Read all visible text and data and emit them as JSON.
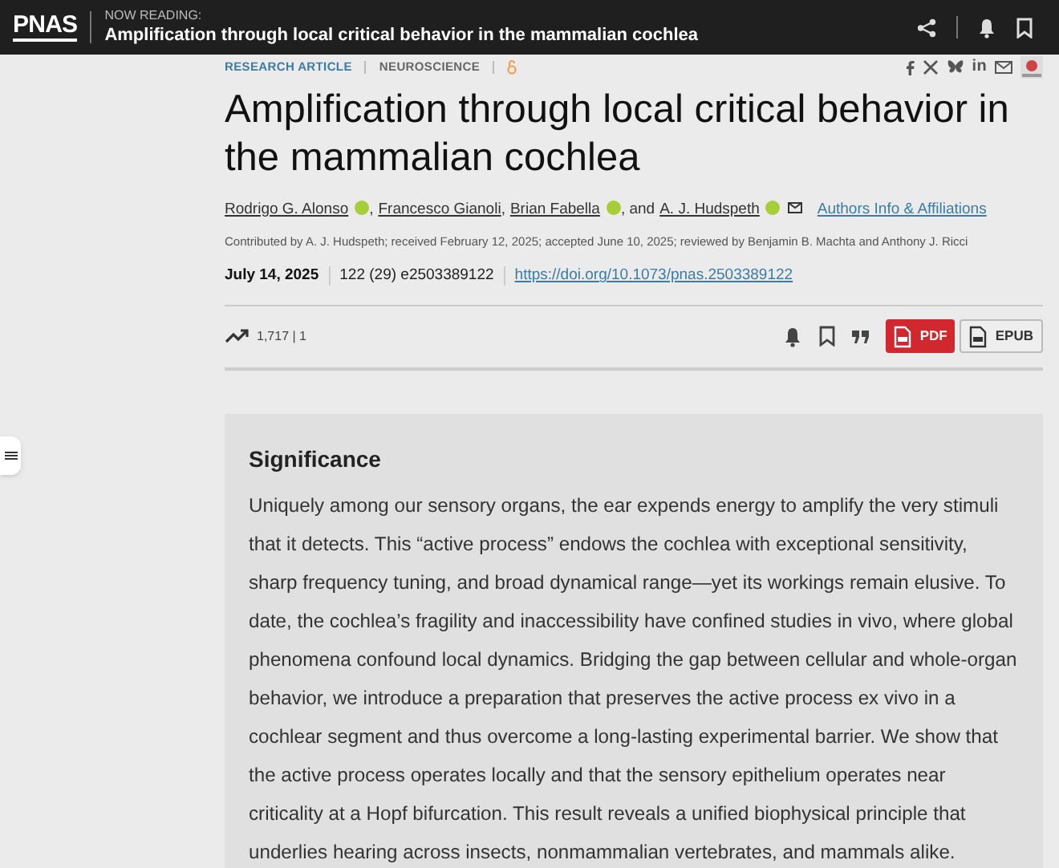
{
  "header": {
    "logo": "PNAS",
    "reading_label": "NOW READING:",
    "reading_title": "Amplification through local critical behavior in the mammalian cochlea"
  },
  "article": {
    "type": "RESEARCH ARTICLE",
    "section": "NEUROSCIENCE",
    "title": "Amplification through local critical behavior in the mammalian cochlea",
    "authors": [
      {
        "name": "Rodrigo G. Alonso",
        "orcid": true,
        "sep": ","
      },
      {
        "name": "Francesco Gianoli",
        "orcid": false,
        "sep": ","
      },
      {
        "name": "Brian Fabella",
        "orcid": true,
        "sep": ", and"
      },
      {
        "name": "A. J. Hudspeth",
        "orcid": true
      }
    ],
    "affiliations_link": "Authors Info & Affiliations",
    "contributed": "Contributed by A. J. Hudspeth; received February 12, 2025; accepted June 10, 2025; reviewed by Benjamin B. Machta and Anthony J. Ricci",
    "date": "July 14, 2025",
    "citation": "122 (29) e2503389122",
    "doi": "https://doi.org/10.1073/pnas.2503389122",
    "metrics": "1,717 | 1",
    "linkedin": "in",
    "pdf": "PDF",
    "epub": "EPUB",
    "significance": {
      "heading": "Significance",
      "text": "Uniquely among our sensory organs, the ear expends energy to amplify the very stimuli that it detects. This “active process” endows the cochlea with exceptional sensitivity, sharp frequency tuning, and broad dynamical range—yet its workings remain elusive. To date, the cochlea’s fragility and inaccessibility have confined studies in vivo, where global phenomena confound local dynamics. Bridging the gap between cellular and whole-organ behavior, we introduce a preparation that preserves the active process ex vivo in a cochlear segment and thus overcome a long-lasting experimental barrier. We show that the active process operates locally and that the sensory epithelium operates near criticality at a Hopf bifurcation. This result reveals a unified biophysical principle that underlies hearing across insects, nonmammalian vertebrates, and mammals alike."
    }
  }
}
